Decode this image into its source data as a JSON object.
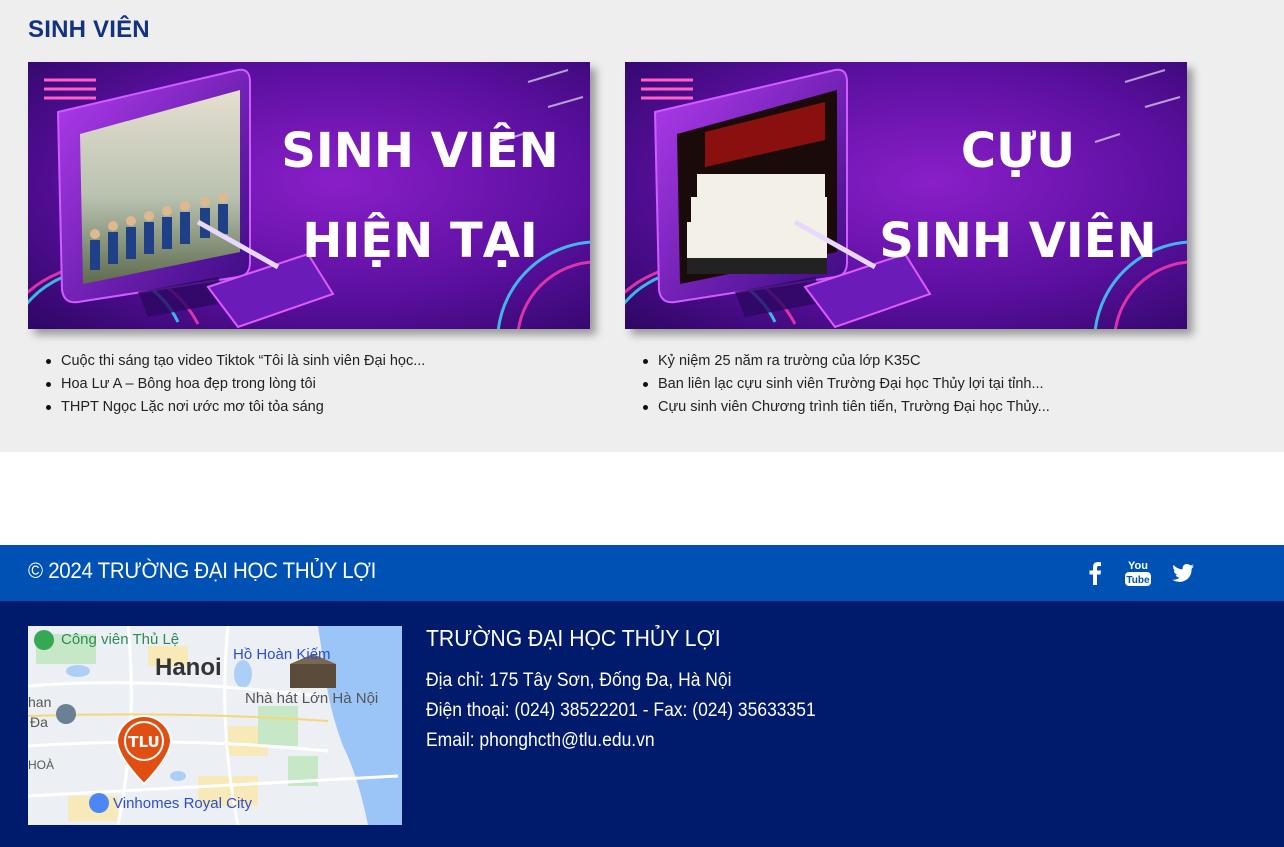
{
  "section": {
    "title": "SINH VIÊN"
  },
  "cards": [
    {
      "banner_line1": "SINH VIÊN",
      "banner_line2": "HIỆN TẠI",
      "news": [
        "Cuộc thi sáng tạo video Tiktok “Tôi là sinh viên Đại học...",
        "Hoa Lư A – Bông hoa đẹp trong lòng tôi",
        "THPT Ngọc Lặc nơi ước mơ tôi tỏa sáng"
      ]
    },
    {
      "banner_line1": "CỰU",
      "banner_line2": "SINH VIÊN",
      "news": [
        "Kỷ niệm 25 năm ra trường của lớp K35C",
        "Ban liên lạc cựu sinh viên Trường Đại học Thủy lợi tại tỉnh...",
        "Cựu sinh viên Chương trình tiên tiến, Trường Đại học Thủy..."
      ]
    }
  ],
  "footer": {
    "copyright": "© 2024 TRƯỜNG ĐẠI HỌC THỦY LỢI",
    "social_icons": [
      "facebook-icon",
      "youtube-icon",
      "twitter-icon"
    ],
    "youtube_text_top": "You",
    "youtube_text_bottom": "Tube",
    "map": {
      "labels": {
        "park": "Công viên Thủ Lệ",
        "city": "Hanoi",
        "lake": "Hồ Hoàn Kiếm",
        "opera": "Nhà hát Lớn Hà Nội",
        "left_fragment": "han",
        "left_fragment2": "Đa",
        "hoa": "HOÀ",
        "vinhomes": "Vinhomes Royal City",
        "pin": "TLU"
      }
    },
    "school_name": "TRƯỜNG ĐẠI HỌC THỦY LỢI",
    "address": "Địa chỉ: 175 Tây Sơn, Đống Đa, Hà Nội",
    "phone": "Điện thoại: (024) 38522201 - Fax: (024) 35633351",
    "email": "Email: phonghcth@tlu.edu.vn"
  },
  "colors": {
    "section_bg": "#eeeeee",
    "title_color": "#123282",
    "footer_top": "#0051b4",
    "footer_main": "#001a6c",
    "banner_purple": "#5a0f9e"
  }
}
